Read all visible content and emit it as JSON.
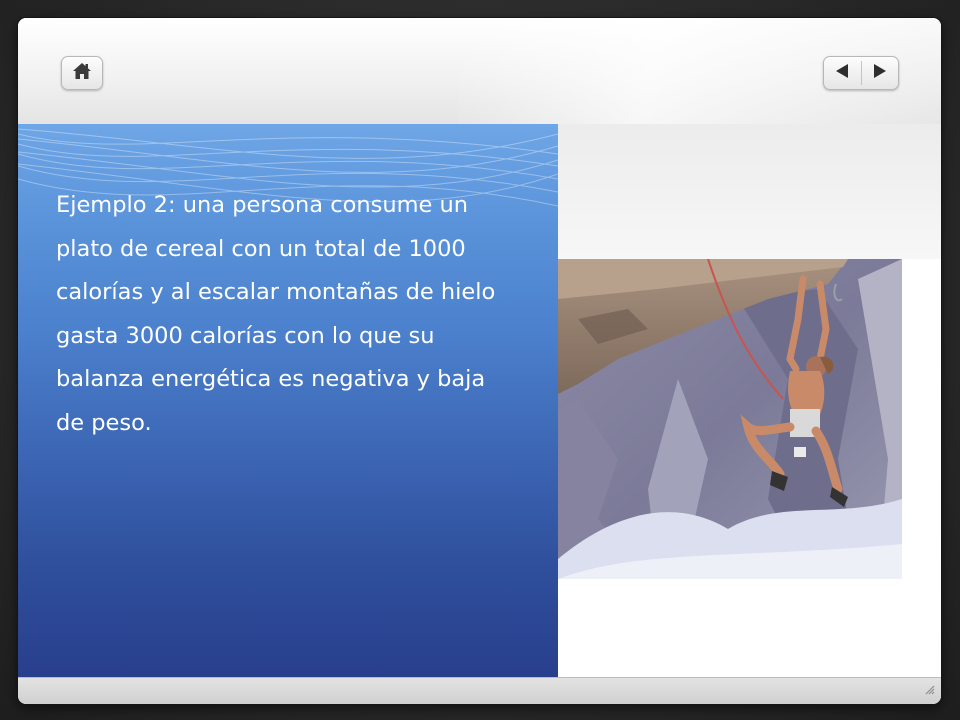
{
  "toolbar": {
    "home_icon": "home-icon",
    "prev_icon": "triangle-left-icon",
    "next_icon": "triangle-right-icon"
  },
  "slide": {
    "body_text": "Ejemplo 2: una persona consume un plato de cereal con un total de 1000 calorías y al escalar montañas de hielo gasta 3000 calorías con lo que su balanza energética es negativa y baja de peso.",
    "image_subject": "rock-climber-photo"
  },
  "colors": {
    "panel_top": "#6ea6e6",
    "panel_bottom": "#283f8c",
    "text": "#ffffff"
  }
}
